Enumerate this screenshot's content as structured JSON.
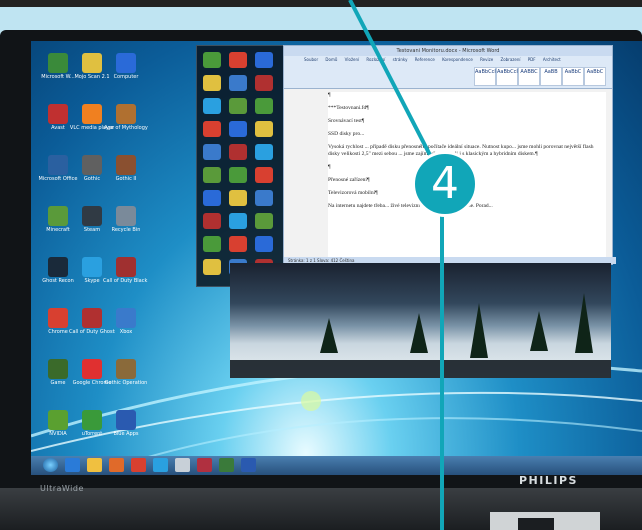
{
  "monitor": {
    "brand_left": "UltraWide",
    "brand_right": "PHILIPS"
  },
  "annotation": {
    "badge": "4"
  },
  "desktop_icons": [
    {
      "label": "Microsoft W..."
    },
    {
      "label": "Mojo Scan 2.1"
    },
    {
      "label": "Computer"
    },
    {
      "label": "Avast"
    },
    {
      "label": "VLC media player"
    },
    {
      "label": "Age of Mythology"
    },
    {
      "label": "Microsoft Office"
    },
    {
      "label": "Gothic"
    },
    {
      "label": "Gothic II"
    },
    {
      "label": "Minecraft"
    },
    {
      "label": "Steam"
    },
    {
      "label": "Recycle Bin"
    },
    {
      "label": "Ghost Recon"
    },
    {
      "label": "Skype"
    },
    {
      "label": "Call of Duty Black Ops"
    },
    {
      "label": "Chrome"
    },
    {
      "label": "Call of Duty Ghosts"
    },
    {
      "label": "Xbox"
    },
    {
      "label": "Game"
    },
    {
      "label": "Google Chrome"
    },
    {
      "label": "Gothic Operation"
    },
    {
      "label": "NVIDIA"
    },
    {
      "label": "uTorrent"
    },
    {
      "label": "Blue Apps"
    }
  ],
  "word": {
    "title": "Testovani Monitoru.docx - Microsoft Word",
    "tabs": "Soubor Domů Vložení Rozložení stránky Reference Korespondence Revize Zobrazení PDF Architect",
    "styles": [
      "AaBbCcI",
      "AaBbCcI",
      "AABBC",
      "AaBB",
      "AaBbC",
      "AaBbC"
    ],
    "doc": [
      "¶",
      "***Testovnani.fd¶",
      "Srovnávací test¶",
      "SSD disky pro...",
      "Vysoká rychlost ... případě disku přenosného počítače ideální situace. Nutnost kupo... jsme mohli porovnat největší flash disky velikosti 2,5\" mezi sebou ... jsme zajímavě porovnali i s klasickým a hybridním diskem.¶",
      "¶",
      "Přenosné zařízení¶",
      "Televizorová mobilní¶",
      "Na internetu najdete třeba... živé televizní vysílání ale většinou ne. Porad..."
    ],
    "status": "Stránka: 1 z 1   Slova: 412   Čeština"
  }
}
